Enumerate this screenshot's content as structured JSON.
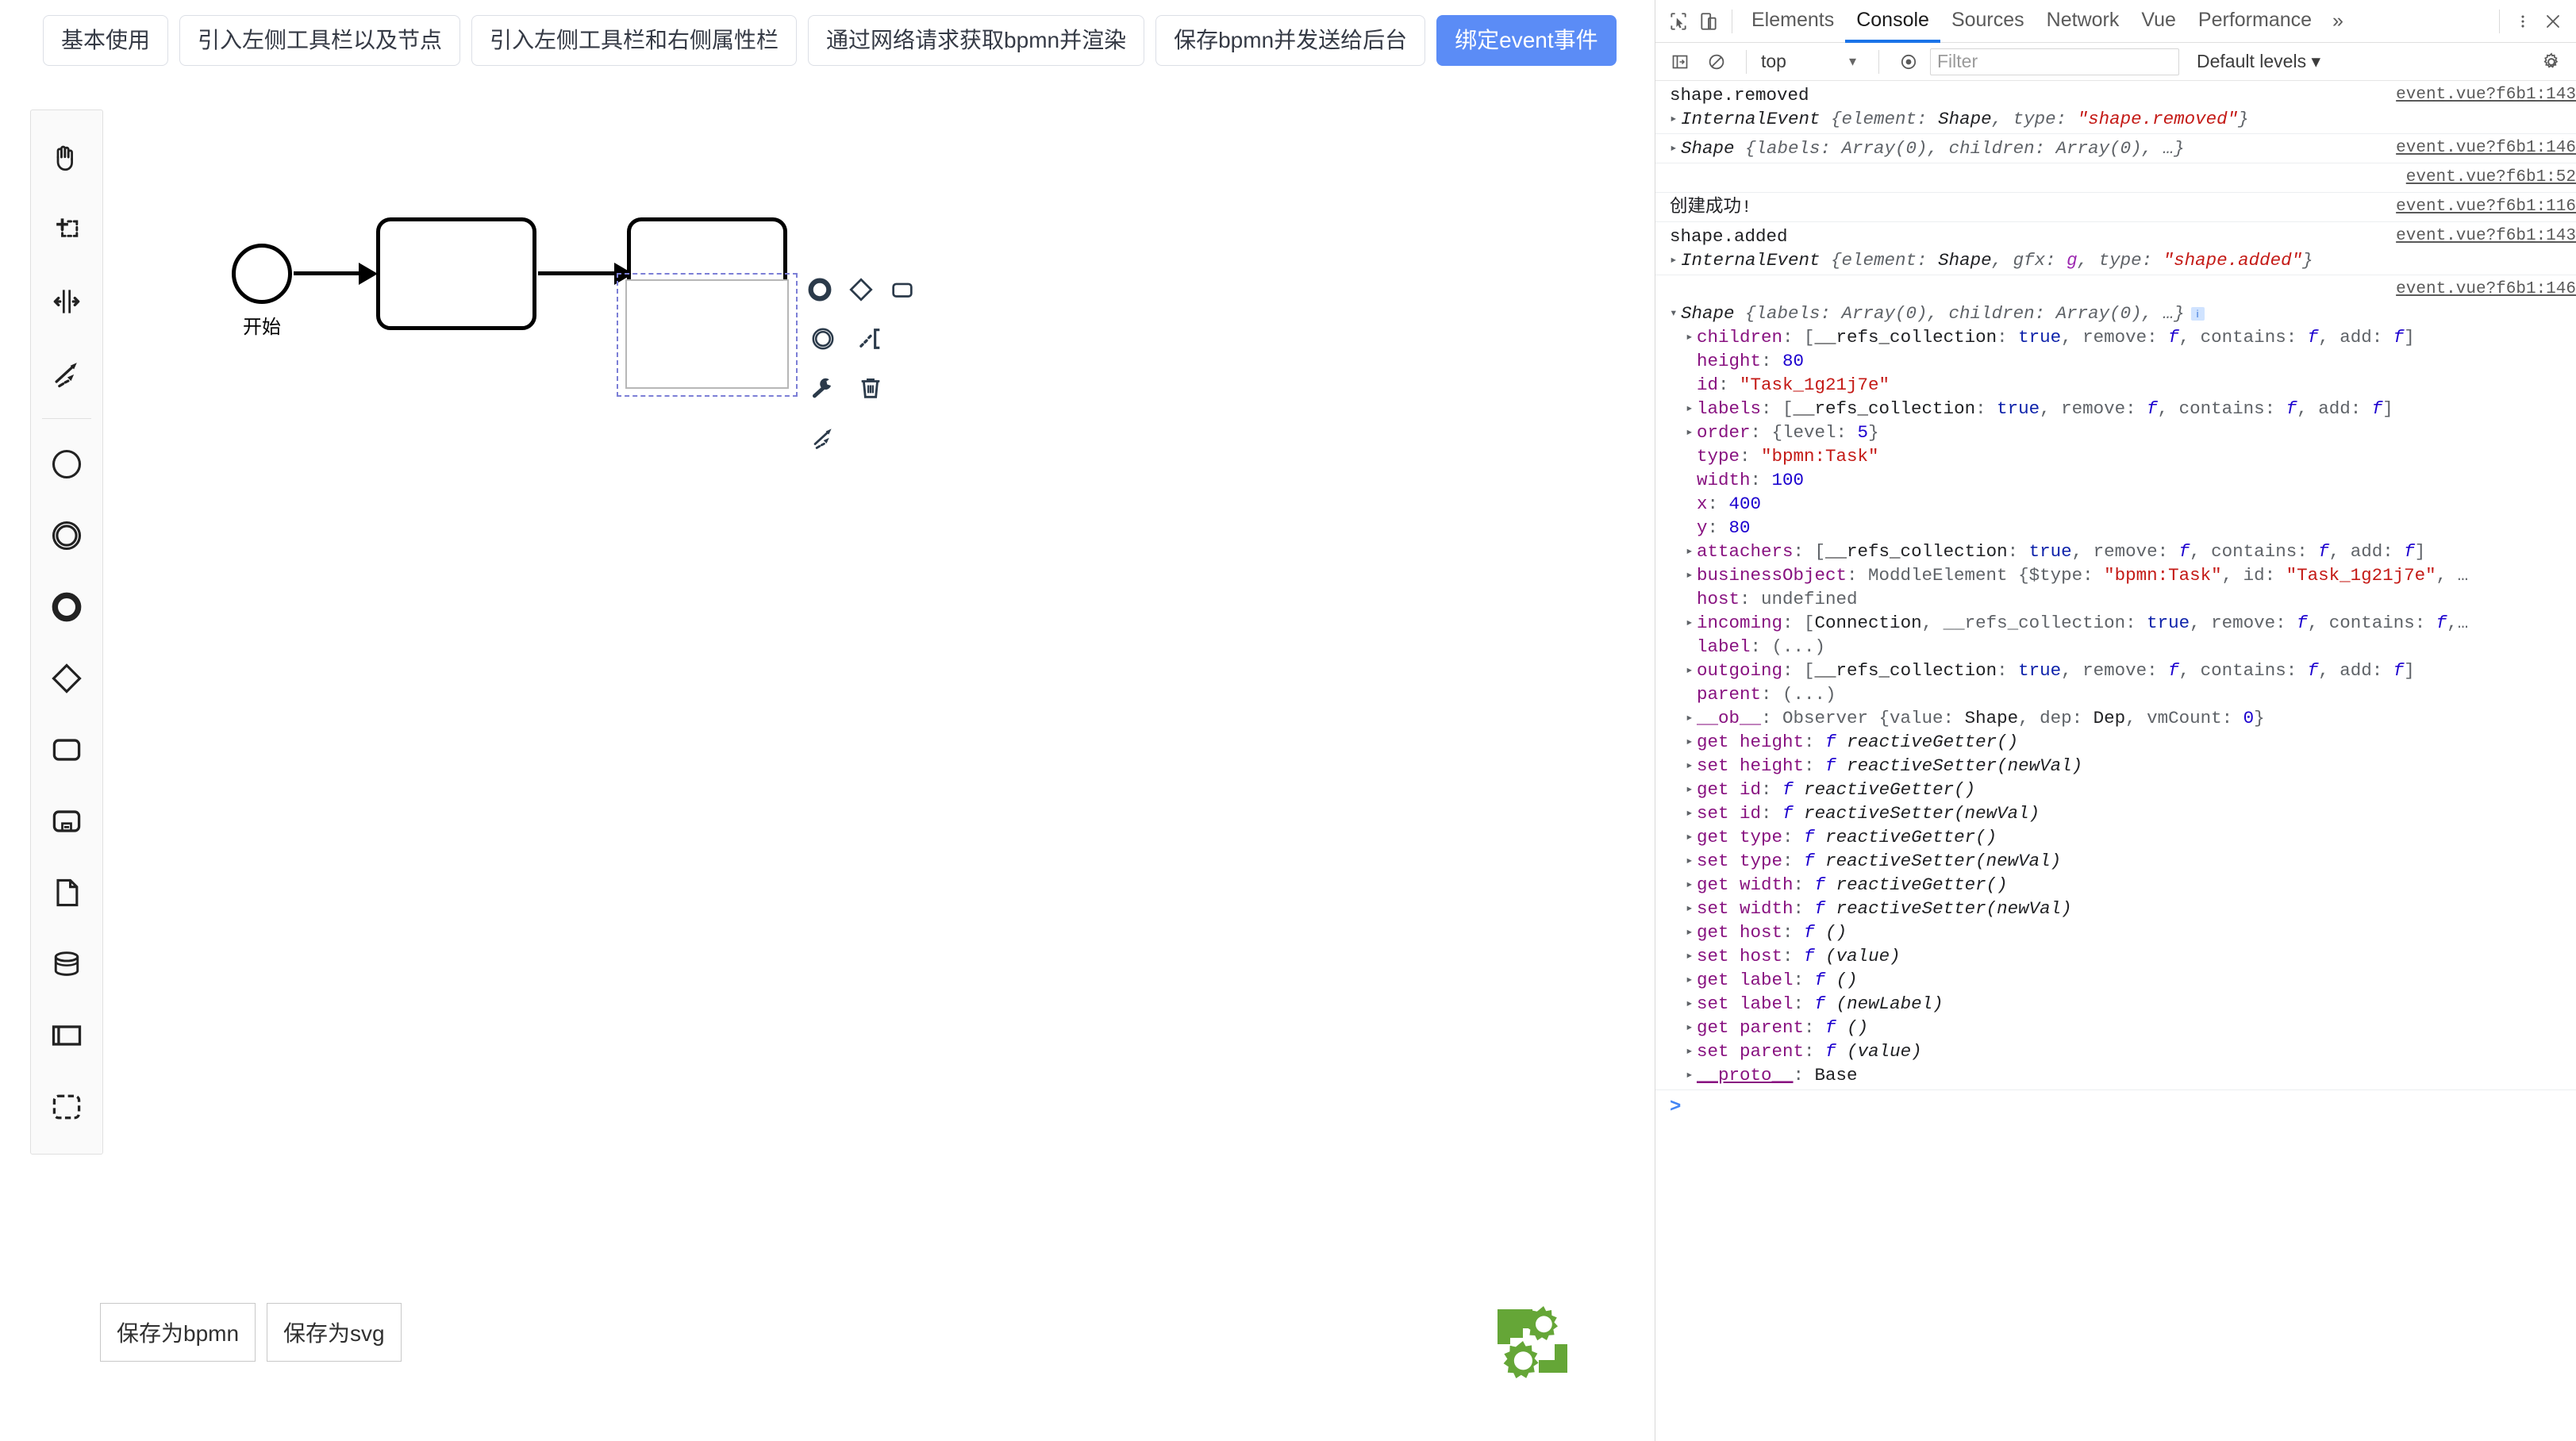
{
  "topbar": {
    "buttons": [
      {
        "label": "基本使用",
        "active": false
      },
      {
        "label": "引入左侧工具栏以及节点",
        "active": false
      },
      {
        "label": "引入左侧工具栏和右侧属性栏",
        "active": false
      },
      {
        "label": "通过网络请求获取bpmn并渲染",
        "active": false
      },
      {
        "label": "保存bpmn并发送给后台",
        "active": false
      },
      {
        "label": "绑定event事件",
        "active": true
      }
    ],
    "active_color": "#5b8cf6"
  },
  "palette": {
    "groups": [
      {
        "items": [
          {
            "name": "hand-tool",
            "title": "激活抓手工具"
          },
          {
            "name": "lasso-tool",
            "title": "激活套索工具"
          },
          {
            "name": "space-tool",
            "title": "激活创建/删除空间工具"
          },
          {
            "name": "global-connect-tool",
            "title": "激活全局连接工具"
          }
        ]
      },
      {
        "items": [
          {
            "name": "start-event",
            "title": "创建开始事件"
          },
          {
            "name": "intermediate-event",
            "title": "创建中间事件"
          },
          {
            "name": "end-event",
            "title": "创建结束事件"
          },
          {
            "name": "gateway",
            "title": "创建网关"
          },
          {
            "name": "task",
            "title": "创建任务"
          },
          {
            "name": "subprocess",
            "title": "创建可折叠子流程"
          },
          {
            "name": "data-object",
            "title": "创建数据对象"
          },
          {
            "name": "data-store",
            "title": "创建数据存储"
          },
          {
            "name": "participant",
            "title": "创建池/参与者"
          },
          {
            "name": "group",
            "title": "创建组"
          }
        ]
      }
    ]
  },
  "diagram": {
    "start_event_label": "开始",
    "nodes": [
      {
        "name": "start-event",
        "label": "开始"
      },
      {
        "name": "task-1",
        "label": ""
      },
      {
        "name": "task-2",
        "label": "",
        "selected": true
      }
    ],
    "selection_color": "#7c7fd6"
  },
  "context_pad": {
    "items": [
      {
        "name": "append-end-event",
        "title": "追加结束事件"
      },
      {
        "name": "append-gateway",
        "title": "追加网关"
      },
      {
        "name": "append-task",
        "title": "追加任务"
      },
      {
        "name": "append-intermediate-event",
        "title": "追加中间事件"
      },
      {
        "name": "append-text-annotation",
        "title": "追加文本注释"
      },
      {
        "name": "change-type",
        "title": "更改类型"
      },
      {
        "name": "delete",
        "title": "删除"
      },
      {
        "name": "connect",
        "title": "连接"
      }
    ]
  },
  "footer": {
    "buttons": [
      {
        "label": "保存为bpmn"
      },
      {
        "label": "保存为svg"
      }
    ],
    "logo_color": "#65a637"
  },
  "devtools": {
    "tabs": [
      {
        "label": "Elements",
        "selected": false
      },
      {
        "label": "Console",
        "selected": true
      },
      {
        "label": "Sources",
        "selected": false
      },
      {
        "label": "Network",
        "selected": false
      },
      {
        "label": "Vue",
        "selected": false
      },
      {
        "label": "Performance",
        "selected": false
      }
    ],
    "more_tabs": "»",
    "toolbar": {
      "context": "top",
      "filter_placeholder": "Filter",
      "filter_value": "",
      "levels": "Default levels"
    },
    "console": {
      "entries": [
        {
          "lines": [
            {
              "indent": 0,
              "tri": "",
              "text": "shape.removed",
              "kind": "plain"
            },
            {
              "indent": 0,
              "tri": "closed",
              "text": "InternalEvent {element: Shape, type: \"shape.removed\"}",
              "kind": "object"
            }
          ],
          "source": "event.vue?f6b1:143"
        },
        {
          "lines": [
            {
              "indent": 0,
              "tri": "closed",
              "text": "Shape {labels: Array(0), children: Array(0), …}",
              "kind": "object"
            }
          ],
          "source": "event.vue?f6b1:146"
        },
        {
          "lines": [],
          "source": "event.vue?f6b1:52"
        },
        {
          "lines": [
            {
              "indent": 0,
              "tri": "",
              "text": "创建成功!",
              "kind": "plain"
            }
          ],
          "source": "event.vue?f6b1:116"
        },
        {
          "lines": [
            {
              "indent": 0,
              "tri": "",
              "text": "shape.added",
              "kind": "plain"
            },
            {
              "indent": 0,
              "tri": "closed",
              "text": "InternalEvent {element: Shape, gfx: g, type: \"shape.added\"}",
              "kind": "object"
            }
          ],
          "source": "event.vue?f6b1:143"
        }
      ],
      "expanded_object": {
        "source": "event.vue?f6b1:146",
        "header": "Shape {labels: Array(0), children: Array(0), …}",
        "properties": [
          "children: [__refs_collection: true, remove: f, contains: f, add: f]",
          "height: 80",
          "id: \"Task_1g21j7e\"",
          "labels: [__refs_collection: true, remove: f, contains: f, add: f]",
          "order: {level: 5}",
          "type: \"bpmn:Task\"",
          "width: 100",
          "x: 400",
          "y: 80",
          "attachers: [__refs_collection: true, remove: f, contains: f, add: f]",
          "businessObject: ModdleElement {$type: \"bpmn:Task\", id: \"Task_1g21j7e\", …",
          "host: undefined",
          "incoming: [Connection, __refs_collection: true, remove: f, contains: f,…",
          "label: (...)",
          "outgoing: [__refs_collection: true, remove: f, contains: f, add: f]",
          "parent: (...)",
          "__ob__: Observer {value: Shape, dep: Dep, vmCount: 0}",
          "get height: f reactiveGetter()",
          "set height: f reactiveSetter(newVal)",
          "get id: f reactiveGetter()",
          "set id: f reactiveSetter(newVal)",
          "get type: f reactiveGetter()",
          "set type: f reactiveSetter(newVal)",
          "get width: f reactiveGetter()",
          "set width: f reactiveSetter(newVal)",
          "get host: f ()",
          "set host: f (value)",
          "get label: f ()",
          "set label: f (newLabel)",
          "get parent: f ()",
          "set parent: f (value)",
          "__proto__: Base"
        ]
      },
      "prompt": ">"
    }
  }
}
